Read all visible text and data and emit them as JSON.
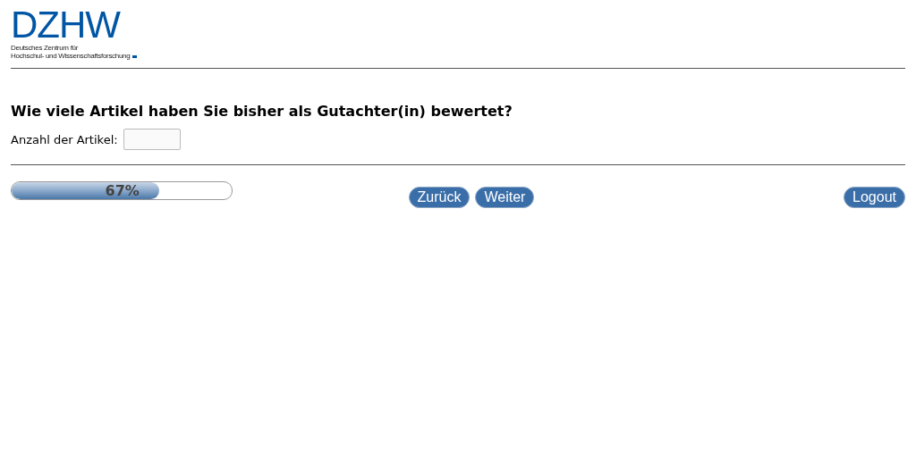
{
  "logo": {
    "wordmark": "DZHW",
    "lines": [
      "Deutsches Zentrum für",
      "Hochschul- und Wissenschaftsforschung"
    ]
  },
  "question": {
    "text": "Wie viele Artikel haben Sie bisher als Gutachter(in) bewertet?",
    "field_label": "Anzahl der Artikel:"
  },
  "progress": {
    "level": 0.67,
    "label": "67%"
  },
  "nav_buttons": [
    "Zurück",
    "Weiter"
  ],
  "logout": "Logout"
}
